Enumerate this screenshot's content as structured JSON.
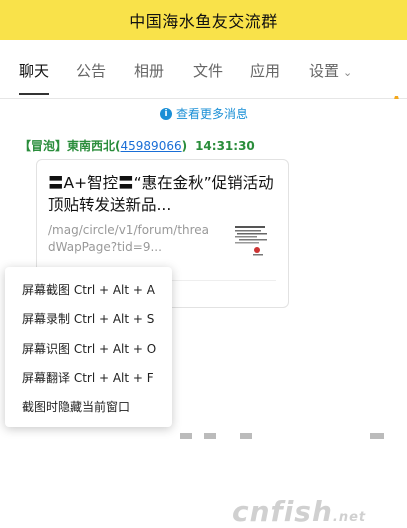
{
  "window": {
    "title": "中国海水鱼友交流群"
  },
  "tabs": [
    {
      "label": "聊天"
    },
    {
      "label": "公告"
    },
    {
      "label": "相册"
    },
    {
      "label": "文件"
    },
    {
      "label": "应用"
    },
    {
      "label": "设置"
    }
  ],
  "chat": {
    "more_messages": "查看更多消息",
    "message": {
      "tag": "【冒泡】",
      "sender": "東南西北",
      "qq_open": "(",
      "qq": "45989066",
      "qq_close": ")",
      "time": "14:31:30",
      "card": {
        "title": "〓A+智控〓“惠在金秋”促销活动顶贴转发送新品...",
        "url": "/mag/circle/v1/forum/threadWapPage?tid=9..."
      }
    }
  },
  "context_menu": [
    {
      "label": "屏幕截图 Ctrl + Alt + A"
    },
    {
      "label": "屏幕录制 Ctrl + Alt + S"
    },
    {
      "label": "屏幕识图 Ctrl + Alt + O"
    },
    {
      "label": "屏幕翻译 Ctrl + Alt + F"
    },
    {
      "label": "截图时隐藏当前窗口"
    }
  ],
  "watermark": {
    "text": "cnfish",
    "suffix": ".net"
  },
  "colors": {
    "titlebar": "#f9e24a",
    "link": "#1a8fd6",
    "sender": "#2a8d3b"
  },
  "icons": [
    "phone-icon",
    "info-icon",
    "chevron-down-icon",
    "thumbnail-image"
  ]
}
